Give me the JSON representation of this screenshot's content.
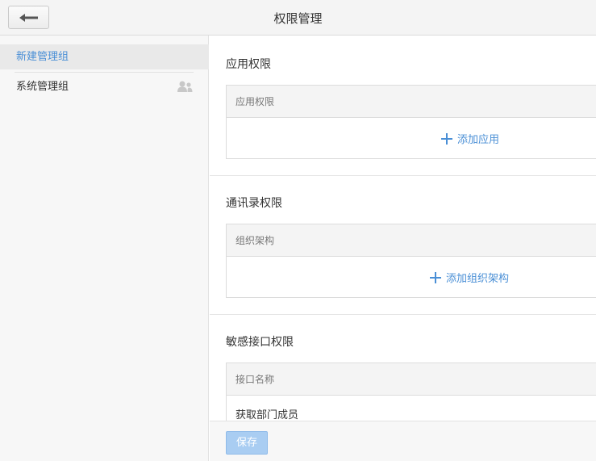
{
  "header": {
    "title": "权限管理",
    "back_icon": "arrow-left-icon"
  },
  "sidebar": {
    "items": [
      {
        "label": "新建管理组",
        "active": true
      },
      {
        "label": "系统管理组",
        "icon": "people-icon"
      }
    ]
  },
  "sections": {
    "app": {
      "title": "应用权限",
      "column": "应用权限",
      "add_label": "添加应用"
    },
    "contacts": {
      "title": "通讯录权限",
      "column": "组织架构",
      "add_label": "添加组织架构"
    },
    "sensitive": {
      "title": "敏感接口权限",
      "column": "接口名称",
      "rows": [
        "获取部门成员"
      ]
    }
  },
  "footer": {
    "save_label": "保存"
  },
  "colors": {
    "accent": "#4a8fd6",
    "save_button": "#a9cdf2"
  }
}
